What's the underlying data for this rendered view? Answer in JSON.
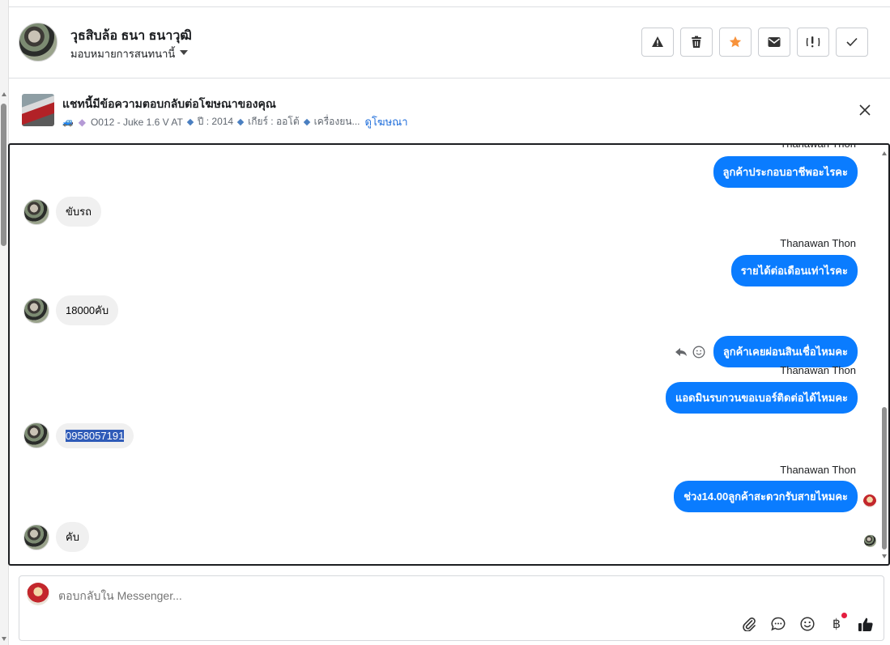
{
  "header": {
    "contact_name": "วุธสิบล้อ ธนา ธนาวุฒิ",
    "assign_label": "มอบหมายการสนทนานี้",
    "actions": [
      {
        "name": "report-button",
        "icon": "warning-icon"
      },
      {
        "name": "delete-button",
        "icon": "trash-icon"
      },
      {
        "name": "star-button",
        "icon": "star-icon"
      },
      {
        "name": "mark-unread-button",
        "icon": "envelope-icon"
      },
      {
        "name": "spam-button",
        "icon": "exclamation-icon"
      },
      {
        "name": "done-button",
        "icon": "check-icon"
      }
    ],
    "star_color": "#f7923b"
  },
  "ad_banner": {
    "title": "แชทนี้มีข้อความตอบกลับต่อโฆษณาของคุณ",
    "listing": "O012 - Juke 1.6 V AT",
    "year": "ปี : 2014",
    "gear": "เกียร์ : ออโต้",
    "engine": "เครื่องยน...",
    "link": "ดูโฆษณา"
  },
  "messages": [
    {
      "direction": "out",
      "sender": "Thanawan Thon",
      "text": "ลูกค้าประกอบอาชีพอะไรคะ"
    },
    {
      "direction": "in",
      "text": "ขับรถ"
    },
    {
      "direction": "out",
      "sender": "Thanawan Thon",
      "text": "รายได้ต่อเดือนเท่าไรคะ"
    },
    {
      "direction": "in",
      "text": "18000คับ"
    },
    {
      "direction": "out",
      "text": "ลูกค้าเคยผ่อนสินเชื่อไหมคะ"
    },
    {
      "direction": "out",
      "sender": "Thanawan Thon",
      "text": "แอดมินรบกวนขอเบอร์ติดต่อได้ไหมคะ"
    },
    {
      "direction": "in",
      "text": "0958057191",
      "selected": true
    },
    {
      "direction": "out",
      "sender": "Thanawan Thon",
      "text": "ช่วง14.00ลูกค้าสะดวกรับสายไหมคะ"
    },
    {
      "direction": "in",
      "text": "คับ"
    }
  ],
  "composer": {
    "placeholder": "ตอบกลับใน Messenger...",
    "tools": [
      "paperclip-icon",
      "chat-bubble-icon",
      "emoji-icon",
      "baht-icon",
      "thumbs-up-icon"
    ]
  },
  "colors": {
    "outgoing_bubble": "#0a7cff",
    "incoming_bubble": "#f0f0f0",
    "link": "#216fdb",
    "notification_dot": "#e41e3f"
  }
}
